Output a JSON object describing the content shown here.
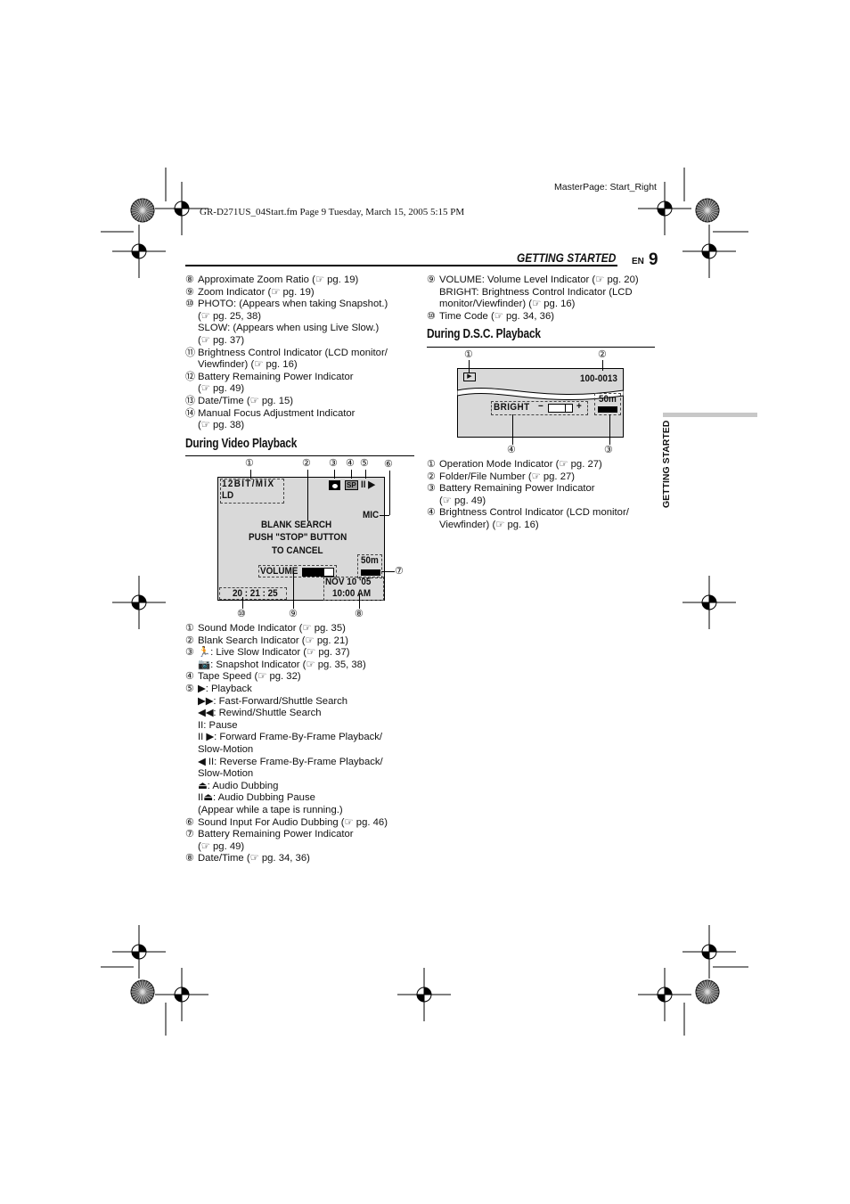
{
  "print_header": {
    "masterpage": "MasterPage: Start_Right",
    "file_info": "GR-D271US_04Start.fm  Page 9  Tuesday, March 15, 2005  5:15 PM"
  },
  "running_head": {
    "section": "GETTING STARTED",
    "lang": "EN",
    "page": "9"
  },
  "side_tab": "GETTING STARTED",
  "left_top_list": [
    {
      "n": "⑧",
      "lines": [
        "Approximate Zoom Ratio (☞ pg. 19)"
      ]
    },
    {
      "n": "⑨",
      "lines": [
        "Zoom Indicator (☞ pg. 19)"
      ]
    },
    {
      "n": "⑩",
      "lines": [
        "PHOTO: (Appears when taking Snapshot.)",
        "(☞ pg. 25, 38)",
        "SLOW: (Appears when using Live Slow.)",
        "(☞ pg. 37)"
      ]
    },
    {
      "n": "⑪",
      "lines": [
        "Brightness Control Indicator (LCD monitor/",
        "Viewfinder) (☞ pg. 16)"
      ]
    },
    {
      "n": "⑫",
      "lines": [
        "Battery Remaining Power Indicator",
        "(☞ pg. 49)"
      ]
    },
    {
      "n": "⑬",
      "lines": [
        "Date/Time (☞ pg. 15)"
      ]
    },
    {
      "n": "⑭",
      "lines": [
        "Manual Focus Adjustment Indicator",
        "(☞ pg. 38)"
      ]
    }
  ],
  "video_playback": {
    "title": "During Video Playback",
    "callouts": [
      "①",
      "②",
      "③",
      "④",
      "⑤",
      "⑥",
      "⑦",
      "⑧",
      "⑨",
      "⑩"
    ],
    "osd": {
      "sound_mode": "12BIT/MIX",
      "ld": "LD",
      "tape_speed": "SP",
      "transport": "II ▶",
      "mic": "MIC",
      "message": [
        "BLANK  SEARCH",
        "PUSH \"STOP\" BUTTON",
        "TO  CANCEL"
      ],
      "battery_time": "50m",
      "volume": "VOLUME",
      "volume_level": 0.7,
      "date": "NOV  10  '05",
      "time": "10:00   AM",
      "timecode": "20 : 21 : 25"
    },
    "list": [
      {
        "n": "①",
        "lines": [
          "Sound Mode Indicator (☞ pg. 35)"
        ]
      },
      {
        "n": "②",
        "lines": [
          "Blank Search Indicator (☞ pg. 21)"
        ]
      },
      {
        "n": "③",
        "lines": [
          "🏃: Live Slow Indicator (☞ pg. 37)",
          "📷: Snapshot Indicator (☞ pg. 35, 38)"
        ]
      },
      {
        "n": "④",
        "lines": [
          "Tape Speed (☞ pg. 32)"
        ]
      },
      {
        "n": "⑤",
        "lines": [
          "▶: Playback",
          "▶▶: Fast-Forward/Shuttle Search",
          "◀◀: Rewind/Shuttle Search",
          "II: Pause",
          "II ▶: Forward Frame-By-Frame Playback/",
          "Slow-Motion",
          "◀ II: Reverse Frame-By-Frame Playback/",
          "Slow-Motion",
          "⏏: Audio Dubbing",
          "II⏏: Audio Dubbing Pause",
          "(Appear while a tape is running.)"
        ]
      },
      {
        "n": "⑥",
        "lines": [
          "Sound Input For Audio Dubbing (☞ pg. 46)"
        ]
      },
      {
        "n": "⑦",
        "lines": [
          "Battery Remaining Power Indicator",
          "(☞ pg. 49)"
        ]
      },
      {
        "n": "⑧",
        "lines": [
          "Date/Time (☞ pg. 34, 36)"
        ]
      }
    ]
  },
  "right_top_list": [
    {
      "n": "⑨",
      "lines": [
        "VOLUME: Volume Level Indicator (☞ pg. 20)",
        "BRIGHT: Brightness Control Indicator (LCD",
        "monitor/Viewfinder) (☞ pg. 16)"
      ]
    },
    {
      "n": "⑩",
      "lines": [
        "Time Code (☞ pg. 34, 36)"
      ]
    }
  ],
  "dsc_playback": {
    "title": "During D.S.C. Playback",
    "callouts": [
      "①",
      "②",
      "③",
      "④"
    ],
    "osd": {
      "mode_icon": "▶",
      "file_number": "100-0013",
      "battery_time": "50m",
      "bright": "BRIGHT",
      "minus": "−",
      "plus": "+"
    },
    "list": [
      {
        "n": "①",
        "lines": [
          "Operation Mode Indicator (☞ pg. 27)"
        ]
      },
      {
        "n": "②",
        "lines": [
          "Folder/File Number (☞ pg. 27)"
        ]
      },
      {
        "n": "③",
        "lines": [
          "Battery Remaining Power Indicator",
          "(☞ pg. 49)"
        ]
      },
      {
        "n": "④",
        "lines": [
          "Brightness Control Indicator (LCD monitor/",
          "Viewfinder) (☞ pg. 16)"
        ]
      }
    ]
  }
}
